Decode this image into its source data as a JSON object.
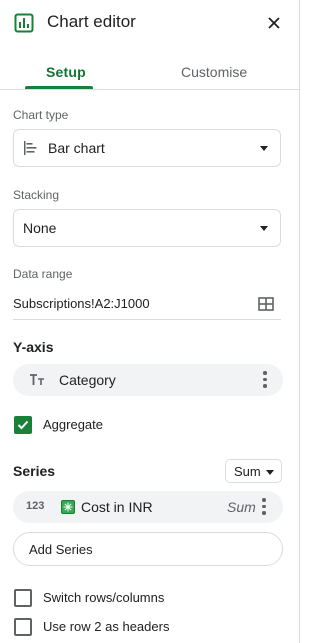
{
  "header": {
    "title": "Chart editor",
    "close_icon": "close-icon"
  },
  "tabs": [
    {
      "label": "Setup",
      "active": true
    },
    {
      "label": "Customise",
      "active": false
    }
  ],
  "chart_type": {
    "label": "Chart type",
    "value": "Bar chart",
    "icon": "bar-chart-icon"
  },
  "stacking": {
    "label": "Stacking",
    "value": "None"
  },
  "data_range": {
    "label": "Data range",
    "value": "Subscriptions!A2:J1000"
  },
  "y_axis": {
    "title": "Y-axis",
    "chip_label": "Category",
    "chip_icon": "text-type-icon",
    "aggregate_label": "Aggregate",
    "aggregate_checked": true
  },
  "series": {
    "title": "Series",
    "aggregation": "Sum",
    "items": [
      {
        "type_label": "123",
        "label": "Cost in INR",
        "aggregation": "Sum"
      }
    ],
    "add_label": "Add Series"
  },
  "options": {
    "switch_rows_label": "Switch rows/columns",
    "switch_rows_checked": false,
    "use_row_headers_label": "Use row 2 as headers",
    "use_row_headers_checked": false
  },
  "colors": {
    "accent": "#188038",
    "border": "#dadce0",
    "chip_bg": "#f1f3f4"
  }
}
